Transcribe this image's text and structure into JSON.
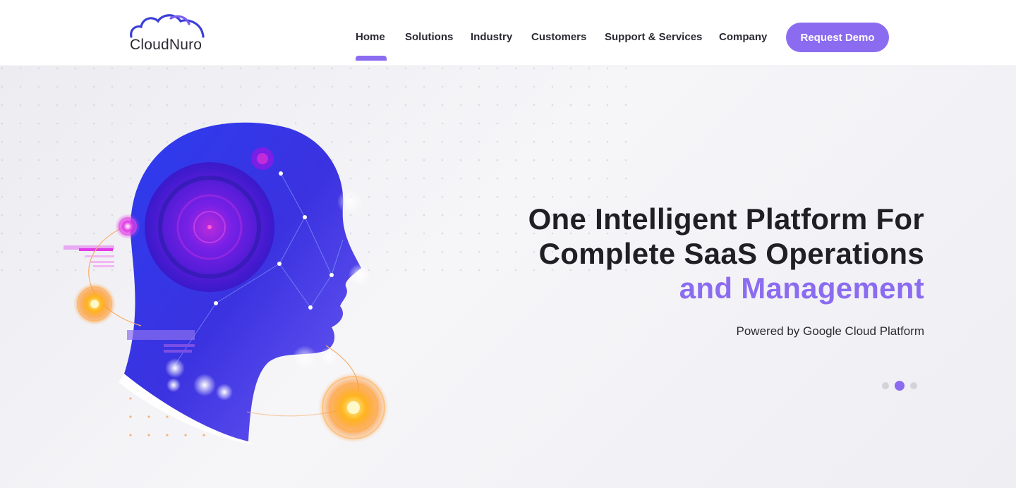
{
  "brand": {
    "name": "CloudNuro",
    "accent_color": "#8b6cf0",
    "logo_icon": "cloud-icon"
  },
  "nav": {
    "items": [
      {
        "label": "Home",
        "active": true
      },
      {
        "label": "Solutions"
      },
      {
        "label": "Industry"
      },
      {
        "label": "Customers"
      },
      {
        "label": "Support & Services"
      },
      {
        "label": "Company"
      }
    ],
    "cta_label": "Request Demo"
  },
  "hero": {
    "headline_lines": [
      "One Intelligent Platform For",
      "Complete SaaS Operations"
    ],
    "headline_accent": "and Management",
    "subheadline": "Powered by Google Cloud Platform",
    "illustration": "ai-head-illustration",
    "carousel": {
      "slide_count": 3,
      "active_index": 1
    }
  }
}
